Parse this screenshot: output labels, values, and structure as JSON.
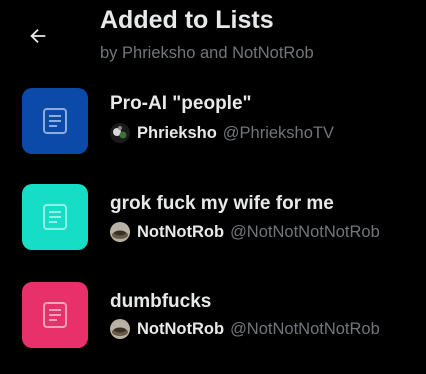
{
  "header": {
    "title": "Added to Lists",
    "subtitle": "by Phrieksho and NotNotRob",
    "back_icon": "arrow-left-icon"
  },
  "lists": [
    {
      "name": "Pro-AI \"people\"",
      "icon_color": "#0b4aa8",
      "icon": "list-icon",
      "owner_name": "Phrieksho",
      "owner_handle": "@PhriekshoTV"
    },
    {
      "name": "grok fuck my wife for me",
      "icon_color": "#16ddc6",
      "icon": "list-icon",
      "owner_name": "NotNotRob",
      "owner_handle": "@NotNotNotNotRob"
    },
    {
      "name": "dumbfucks",
      "icon_color": "#e8316b",
      "icon": "list-icon",
      "owner_name": "NotNotRob",
      "owner_handle": "@NotNotNotNotRob"
    }
  ]
}
